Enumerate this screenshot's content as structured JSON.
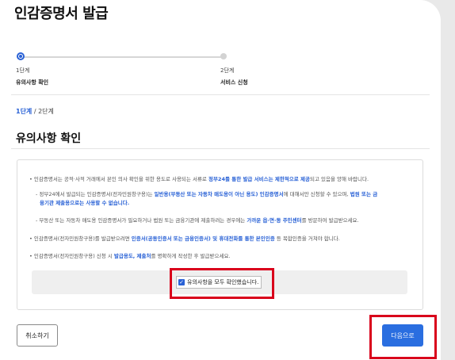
{
  "page": {
    "title": "인감증명서 발급"
  },
  "steps": [
    {
      "num": "1단계",
      "name": "유의사항 확인",
      "state": "active"
    },
    {
      "num": "2단계",
      "name": "서비스 신청",
      "state": "inactive"
    }
  ],
  "breadcrumb": {
    "current": "1단계",
    "separator": " / ",
    "next": "2단계"
  },
  "section": {
    "title": "유의사항 확인"
  },
  "notice": {
    "p1": {
      "a": "• 인감증명서는 공적·사적 거래에서 본인 의사 확인을 위한 용도로 사용되는 서류로 ",
      "b": "정부24를 통한 발급 서비스는 제한적으로 제공",
      "c": "되고 있음을 양해 바랍니다."
    },
    "p2": {
      "a": "- 정부24에서 발급되는 인감증명서(전자민원창구용)는 ",
      "b": "일반용(부동산 또는 자동차 매도용이 아닌 용도) 인감증명서",
      "c": "에 대해서만 신청할 수 있으며, ",
      "d": "법원 또는 금융기관 제출용으로는 사용할 수 없습니다.",
      "d1": "법원 또는 금",
      "d2": "융기관 제출용으로는 사용할 수 없습니다."
    },
    "p3": {
      "a": "- 부동산 또는 자동차 매도용 인감증명서가 필요하거나 법원 또는 금융기관에 제출하려는 경우에는 ",
      "b": "가까운 읍·면·동 주민센터",
      "c": "를 방문하여 발급받으세요."
    },
    "p4": {
      "a": "• 인감증명서(전자민원창구용)를 발급받으려면 ",
      "b": "인증서(공동인증서 또는 금융인증서) 및 휴대전화를 통한 본인인증",
      "c": " 등 복합인증을 거쳐야 합니다."
    },
    "p5": {
      "a": "• 인감증명서(전자민원창구용) 신청 시 ",
      "b": "발급용도, 제출처",
      "c": "를 명확하게 작성한 후 발급받으세요."
    }
  },
  "confirm": {
    "label": "유의사항을 모두 확인했습니다.",
    "checked": true
  },
  "buttons": {
    "cancel": "취소하기",
    "next": "다음으로"
  },
  "colors": {
    "accent": "#2a62d6",
    "button": "#2a6ee0",
    "highlight_frame": "#d9001b"
  }
}
